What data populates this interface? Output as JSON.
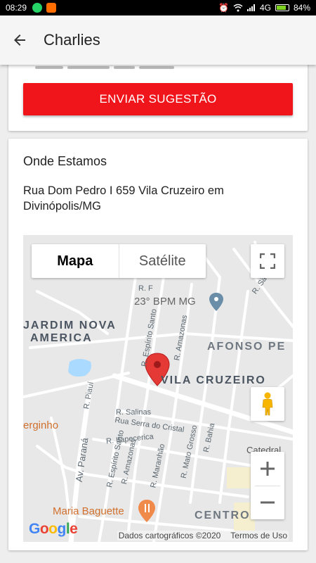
{
  "status_bar": {
    "time": "08:29",
    "network": "4G",
    "battery": "84%",
    "battery_level": 0.84
  },
  "app_bar": {
    "title": "Charlies"
  },
  "suggestion": {
    "button_label": "ENVIAR SUGESTÃO"
  },
  "location": {
    "title": "Onde Estamos",
    "address": "Rua Dom Pedro I 659 Vila Cruzeiro em Divinópolis/MG"
  },
  "map": {
    "type_tabs": [
      {
        "label": "Mapa",
        "active": true
      },
      {
        "label": "Satélite",
        "active": false
      }
    ],
    "area_labels": {
      "jardim": "JARDIM NOVA",
      "america": "AMERICA",
      "afonso": "AFONSO PE",
      "vila_cruzeiro": "VILA CRUZEIRO",
      "centro": "CENTRO"
    },
    "poi": {
      "bpm": "23° BPM MG",
      "baguette": "Maria Baguette",
      "serginho": "erginho",
      "catedral": "Catedral"
    },
    "streets": {
      "espirito_santo_1": "R. Espírito Santo",
      "espirito_santo_2": "R. Espírito Santo",
      "amazonas_1": "R. Amazonas",
      "amazonas_2": "R. Amazonas",
      "salinas": "R. Salinas",
      "serra_cristal": "Rua Serra do Cristal",
      "itapecerica": "R. Itapecerica",
      "parana": "Av. Paraná",
      "piaui": "R. Piauí",
      "maranhao": "R. Maranhão",
      "mato_grosso": "R. Mato Grosso",
      "bahia": "R. Bahia",
      "sao_ro": "R. São Ro",
      "rf": "R. F"
    },
    "logo": "Google",
    "attribution": "Dados cartográficos ©2020",
    "terms": "Termos de Uso",
    "colors": {
      "pin": "#e53935",
      "poi_pin": "#6b8ea8",
      "button": "#f0141b"
    }
  }
}
